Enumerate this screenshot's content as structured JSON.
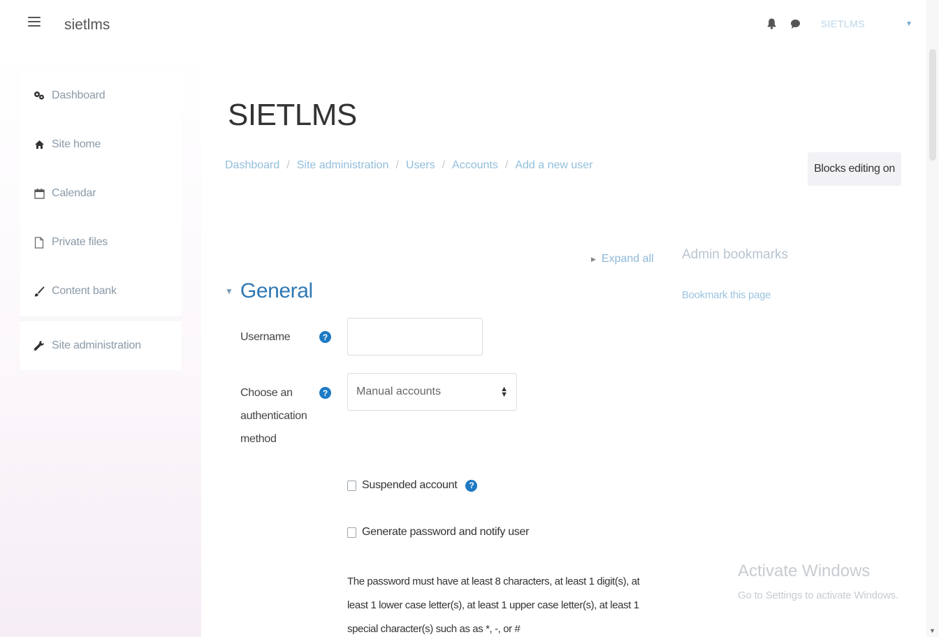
{
  "navbar": {
    "brand": "sietlms",
    "user_name": "SIETLMS",
    "icons": [
      "hamburger-icon",
      "bell-icon",
      "chat-icon",
      "caret-down-icon"
    ]
  },
  "drawer": {
    "items": [
      {
        "label": "Dashboard",
        "icon": "dashboard-icon"
      },
      {
        "label": "Site home",
        "icon": "home-icon"
      },
      {
        "label": "Calendar",
        "icon": "calendar-icon"
      },
      {
        "label": "Private files",
        "icon": "file-icon"
      },
      {
        "label": "Content bank",
        "icon": "paintbrush-icon"
      },
      {
        "label": "Site administration",
        "icon": "wrench-icon"
      }
    ]
  },
  "page": {
    "title": "SIETLMS",
    "breadcrumb": [
      "Dashboard",
      "Site administration",
      "Users",
      "Accounts",
      "Add a new user"
    ],
    "blocks_button": "Blocks editing on",
    "expand_all": "Expand all"
  },
  "form": {
    "section_title": "General",
    "username_label": "Username",
    "username_value": "",
    "auth_label_lines": [
      "Choose an",
      "authentication",
      "method"
    ],
    "auth_selected": "Manual accounts",
    "suspended_label": "Suspended account",
    "suspended_checked": false,
    "generate_label": "Generate password and notify user",
    "generate_checked": false,
    "password_rule_lines": [
      "The password must have at least 8 characters, at least 1 digit(s), at",
      "least 1 lower case letter(s), at least 1 upper case letter(s), at least 1",
      "special character(s) such as as *, -, or #"
    ]
  },
  "admin_block": {
    "title": "Admin bookmarks",
    "link": "Bookmark this page"
  },
  "watermark": {
    "title": "Activate Windows",
    "subtitle": "Go to Settings to activate Windows."
  },
  "colors": {
    "link": "#92bedc",
    "section_title": "#2f78b3",
    "help_icon": "#1d7ac4"
  }
}
